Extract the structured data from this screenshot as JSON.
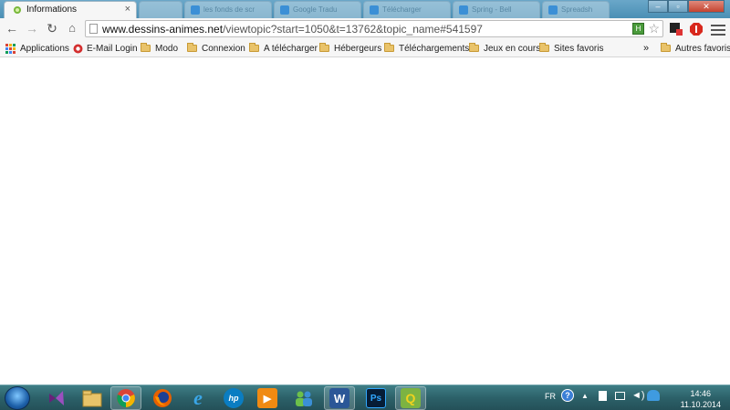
{
  "browser": {
    "active_tab": {
      "title": "Informations",
      "close": "×"
    },
    "background_tabs": [
      {
        "label": ""
      },
      {
        "label": "les fonds de scr"
      },
      {
        "label": "Google Tradu"
      },
      {
        "label": "Télécharger"
      },
      {
        "label": "Spring - Bell"
      },
      {
        "label": "Spreadsh"
      }
    ],
    "url": {
      "host": "www.dessins-animes.net",
      "path": "/viewtopic?start=1050&t=13762&topic_name#541597"
    },
    "extension_label": "H"
  },
  "bookmarks": {
    "items": [
      {
        "label": "Applications",
        "icon": "apps-grid-icon"
      },
      {
        "label": "E-Mail Login",
        "icon": "email-icon"
      },
      {
        "label": "Modo",
        "icon": "folder-icon"
      },
      {
        "label": "Connexion",
        "icon": "folder-icon"
      },
      {
        "label": "A télécharger",
        "icon": "folder-icon"
      },
      {
        "label": "Hébergeurs",
        "icon": "folder-icon"
      },
      {
        "label": "Téléchargements",
        "icon": "folder-icon"
      },
      {
        "label": "Jeux en cours",
        "icon": "folder-icon"
      },
      {
        "label": "Sites favoris",
        "icon": "folder-icon"
      }
    ],
    "overflow": "»",
    "other": "Autres favoris"
  },
  "taskbar": {
    "apps": [
      {
        "name": "visual-studio",
        "label": ""
      },
      {
        "name": "file-explorer",
        "label": ""
      },
      {
        "name": "chrome",
        "label": ""
      },
      {
        "name": "firefox",
        "label": ""
      },
      {
        "name": "internet-explorer",
        "label": "e"
      },
      {
        "name": "hp",
        "label": "hp"
      },
      {
        "name": "media-player",
        "label": "▶"
      },
      {
        "name": "network-people",
        "label": ""
      },
      {
        "name": "word",
        "label": "W"
      },
      {
        "name": "photoshop",
        "label": "Ps"
      },
      {
        "name": "qgis",
        "label": "Q"
      }
    ],
    "tray": {
      "language": "FR",
      "time": "14:46",
      "date": "11.10.2014"
    }
  },
  "colors": {
    "taskbar": "#2c6169",
    "tabstrip": "#5a9bc0",
    "chrome_red": "#db4437",
    "chrome_green": "#0f9d58",
    "chrome_yellow": "#f4b400"
  }
}
